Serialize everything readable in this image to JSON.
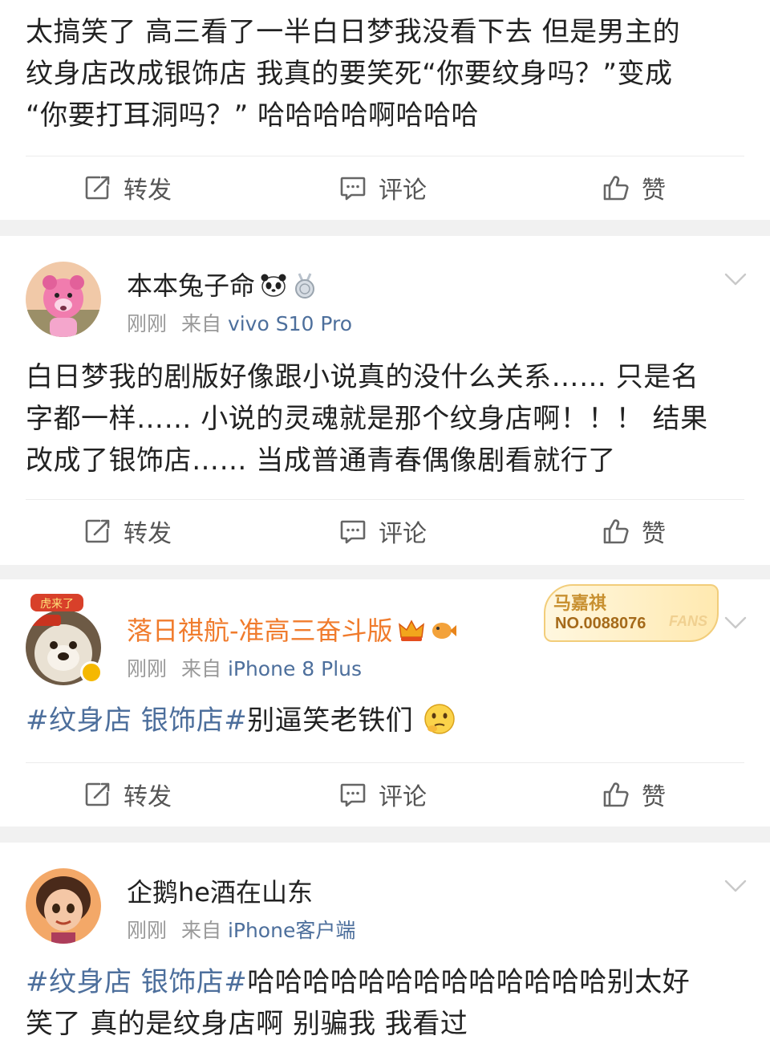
{
  "actions": {
    "repost": "转发",
    "comment": "评论",
    "like": "赞"
  },
  "posts": [
    {
      "text_lines": [
        "太搞笑了 高三看了一半白日梦我没看下去 但是男主的",
        "纹身店改成银饰店 我真的要笑死“你要纹身吗？”变成",
        "“你要打耳洞吗？” 哈哈哈哈啊哈哈哈"
      ]
    },
    {
      "username": "本本兔子命",
      "time": "刚刚",
      "from_prefix": "来自",
      "source": "vivo S10 Pro",
      "text_lines": [
        "白日梦我的剧版好像跟小说真的没什么关系…… 只是名",
        "字都一样…… 小说的灵魂就是那个纹身店啊！！！ 结果",
        "改成了银饰店…… 当成普通青春偶像剧看就行了"
      ]
    },
    {
      "username": "落日祺航-准高三奋斗版",
      "time": "刚刚",
      "from_prefix": "来自",
      "source": "iPhone 8 Plus",
      "fans_badge": {
        "name": "马嘉祺",
        "number": "NO.0088076",
        "label": "FANS"
      },
      "hashtag": "#纹身店 银饰店#",
      "text_after": "别逼笑老铁们"
    },
    {
      "username": "企鹅he酒在山东",
      "time": "刚刚",
      "from_prefix": "来自",
      "source": "iPhone客户端",
      "hashtag": "#纹身店 银饰店#",
      "text_line1_after": "哈哈哈哈哈哈哈哈哈哈哈哈哈别太好",
      "text_line2": "笑了 真的是纹身店啊 别骗我 我看过"
    }
  ]
}
